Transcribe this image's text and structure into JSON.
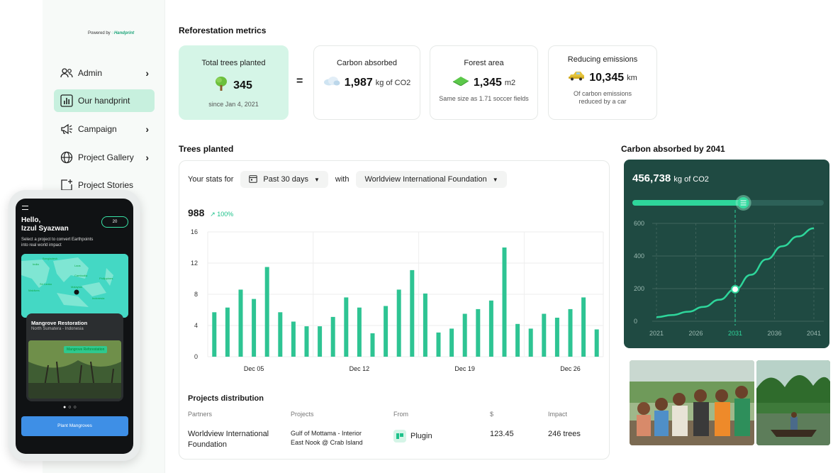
{
  "sidebar": {
    "powered_prefix": "Powered by",
    "powered_brand": "Handprint",
    "items": [
      {
        "label": "Admin",
        "has_chevron": true
      },
      {
        "label": "Our handprint",
        "active": true
      },
      {
        "label": "Campaign",
        "has_chevron": true
      },
      {
        "label": "Project Gallery",
        "has_chevron": true
      },
      {
        "label": "Project Stories"
      }
    ],
    "chevron": "›"
  },
  "metrics": {
    "title": "Reforestation metrics",
    "equals": "=",
    "trees": {
      "label": "Total trees planted",
      "value": "345",
      "sub": "since Jan 4, 2021",
      "icon": "tree-icon"
    },
    "carbon": {
      "label": "Carbon absorbed",
      "value": "1,987",
      "unit": "kg of CO2",
      "icon": "cloud-icon"
    },
    "forest": {
      "label": "Forest area",
      "value": "1,345",
      "unit": "m2",
      "sub": "Same size as 1.71 soccer fields",
      "icon": "field-icon"
    },
    "emissions": {
      "label": "Reducing emissions",
      "value": "10,345",
      "unit": "km",
      "sub1": "Of carbon emissions",
      "sub2": "reduced by a car",
      "icon": "car-icon"
    }
  },
  "trees_planted": {
    "title": "Trees planted",
    "stats_prefix": "Your stats for",
    "period": "Past 30 days",
    "with_label": "with",
    "partner": "Worldview International Foundation",
    "total": "988",
    "delta": "↗ 100%"
  },
  "chart_data": [
    {
      "type": "bar",
      "title": "Trees planted",
      "ylim": [
        0,
        16
      ],
      "yticks": [
        "0",
        "4",
        "8",
        "12",
        "16"
      ],
      "xtick_labels": [
        {
          "label": "Dec 05",
          "index": 3
        },
        {
          "label": "Dec 12",
          "index": 11
        },
        {
          "label": "Dec 19",
          "index": 19
        },
        {
          "label": "Dec 26",
          "index": 27
        }
      ],
      "values": [
        5.7,
        6.3,
        8.6,
        7.4,
        11.5,
        5.7,
        4.5,
        3.9,
        3.9,
        5.1,
        7.6,
        6.3,
        3.0,
        6.5,
        8.6,
        11.1,
        8.1,
        3.1,
        3.6,
        5.5,
        6.1,
        7.2,
        14.0,
        4.2,
        3.6,
        5.5,
        5.0,
        6.1,
        7.6,
        3.5
      ],
      "grid": true,
      "color": "#2ec493"
    },
    {
      "type": "line",
      "title": "Carbon absorbed by 2041",
      "value_label": "456,738",
      "unit_label": "kg of CO2",
      "x": [
        2021,
        2023,
        2025,
        2027,
        2029,
        2031,
        2033,
        2035,
        2037,
        2039,
        2041
      ],
      "y": [
        25,
        38,
        58,
        88,
        132,
        196,
        285,
        380,
        460,
        520,
        570
      ],
      "xticks": [
        "2021",
        "2026",
        "2031",
        "2036",
        "2041"
      ],
      "yticks": [
        "0",
        "200",
        "400",
        "600"
      ],
      "ylim": [
        0,
        600
      ],
      "highlight_x": 2031,
      "slider_fraction": 0.58,
      "colors": {
        "background": "#1f4a42",
        "line": "#2ed69b",
        "grid": "#4b6e66",
        "tick": "#9ab8b0"
      }
    }
  ],
  "carbon_title": "Carbon absorbed by 2041",
  "distribution": {
    "title": "Projects distribution",
    "headers": [
      "Partners",
      "Projects",
      "From",
      "$",
      "Impact"
    ],
    "row": {
      "partner_line1": "Worldview International",
      "partner_line2": "Foundation",
      "project_line1": "Gulf of Mottama - Interior",
      "project_line2": "East Nook @ Crab Island",
      "from": "Plugin",
      "amount": "123.45",
      "impact": "246 trees"
    }
  },
  "phone": {
    "greeting_line1": "Hello,",
    "greeting_line2": "Izzul Syazwan",
    "points": "20",
    "intro_line1": "Select a project to convert Earthpoints",
    "intro_line2": "into real world impact",
    "map_labels": [
      "Bangladesh",
      "India",
      "Laos",
      "Cambodia",
      "Philippines",
      "Sri Lanka",
      "Maldives",
      "Malaysia",
      "Indonesia"
    ],
    "card_title": "Mangrove Restoration",
    "card_sub": "North Sumatera - Indonesia",
    "card_tag": "Mangrove Reforestation",
    "dots": "●○○",
    "button": "Plant Mangroves"
  }
}
